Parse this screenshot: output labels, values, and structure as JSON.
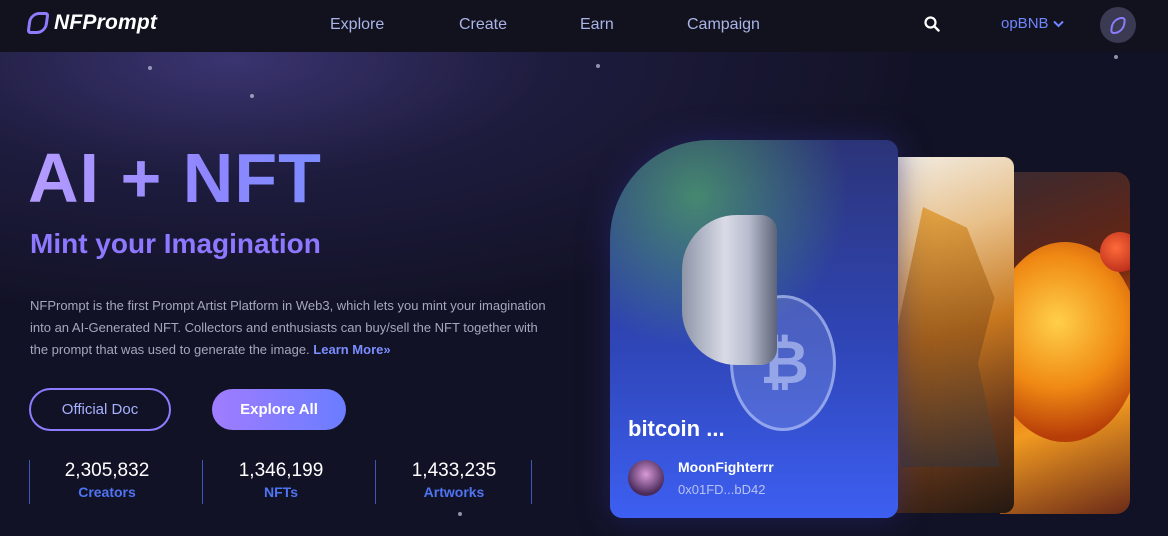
{
  "header": {
    "brand": "NFPrompt",
    "nav": [
      "Explore",
      "Create",
      "Earn",
      "Campaign"
    ],
    "network": "opBNB"
  },
  "hero": {
    "title": "AI + NFT",
    "subtitle": "Mint your Imagination",
    "description": "NFPrompt is the first Prompt Artist Platform in Web3, which lets you mint your imagination into an AI-Generated NFT. Collectors and enthusiasts can buy/sell the NFT together with the prompt that was used to generate the image.",
    "learn_more": "Learn More»",
    "buttons": {
      "doc": "Official Doc",
      "explore": "Explore All"
    }
  },
  "stats": [
    {
      "value": "2,305,832",
      "label": "Creators"
    },
    {
      "value": "1,346,199",
      "label": "NFTs"
    },
    {
      "value": "1,433,235",
      "label": "Artworks"
    }
  ],
  "featured_card": {
    "title": "bitcoin ...",
    "owner": "MoonFighterrr",
    "address": "0x01FD...bD42"
  },
  "icons": {
    "search": "search-icon",
    "chevron": "chevron-down-icon",
    "logo": "nfprompt-logo-icon"
  },
  "colors": {
    "accent": "#8c79ff",
    "link": "#4f74f2",
    "background": "#121226"
  }
}
